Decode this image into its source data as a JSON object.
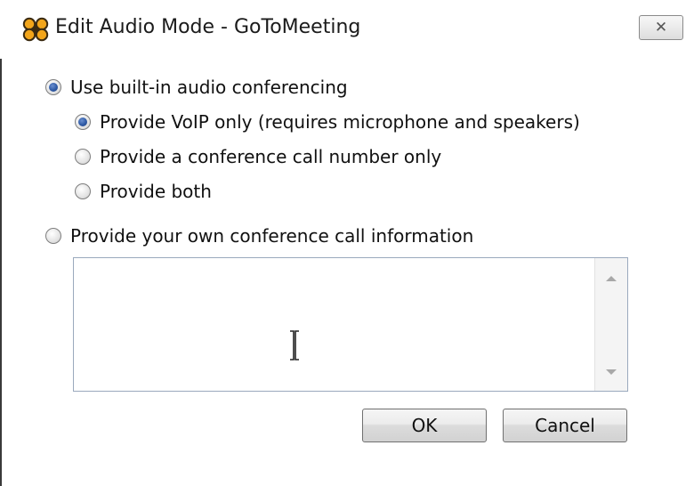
{
  "window": {
    "title": "Edit Audio Mode - GoToMeeting",
    "app_icon": "gotomeeting-flower-icon",
    "close_icon": "close-icon",
    "close_glyph": "✕"
  },
  "options": {
    "builtin": {
      "label": "Use built-in audio conferencing",
      "checked": true
    },
    "voip": {
      "label": "Provide VoIP only (requires microphone and speakers)",
      "checked": true
    },
    "call_number": {
      "label": "Provide a conference call number only",
      "checked": false
    },
    "both": {
      "label": "Provide both",
      "checked": false
    },
    "own": {
      "label": "Provide your own conference call information",
      "checked": false
    }
  },
  "conference_info": {
    "value": ""
  },
  "buttons": {
    "ok": "OK",
    "cancel": "Cancel"
  },
  "colors": {
    "radio_selected": "#2f5aa5",
    "icon_orange": "#f2a51a",
    "icon_dark": "#3a2a10"
  }
}
